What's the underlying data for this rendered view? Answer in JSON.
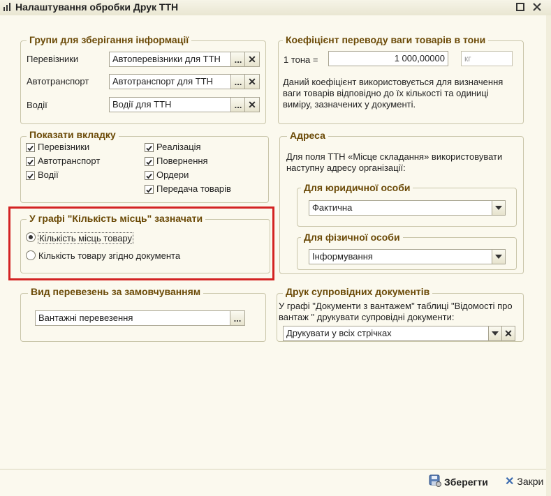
{
  "window": {
    "title": "Налаштування обробки Друк ТТН"
  },
  "groups_storage": {
    "title": "Групи для зберігання інформації",
    "rows": [
      {
        "label": "Перевізники",
        "value": "Автоперевізники для ТТН"
      },
      {
        "label": "Автотранспорт",
        "value": "Автотранспорт для ТТН"
      },
      {
        "label": "Водії",
        "value": "Водії для ТТН"
      }
    ]
  },
  "weight_coef": {
    "title": "Коефіцієнт переводу ваги товарів в тони",
    "ton_label": "1 тона =",
    "value": "1 000,00000",
    "unit": "кг",
    "note": "Даний коефіцієнт використовується для визначення ваги товарів відповідно до їх кількості та одиниці виміру, зазначених у документі."
  },
  "show_tab": {
    "title": "Показати вкладку",
    "left": [
      "Перевізники",
      "Автотранспорт",
      "Водії"
    ],
    "right": [
      "Реалізація",
      "Повернення",
      "Ордери",
      "Передача товарів"
    ]
  },
  "places": {
    "title": "У графі \"Кількість місць\" зазначати",
    "options": [
      "Кількість місць товару",
      "Кількість товару згідно документа"
    ],
    "selected": 0
  },
  "address": {
    "title": "Адреса",
    "note": "Для поля ТТН «Місце складання» використовувати наступну адресу організації:",
    "legal_title": "Для юридичної особи",
    "legal_value": "Фактична",
    "person_title": "Для фізичної особи",
    "person_value": "Інформування"
  },
  "transport_kind": {
    "title": "Вид перевезень за замовчуванням",
    "value": "Вантажні перевезення"
  },
  "docs": {
    "title": "Друк супровідних документів",
    "note": "У графі \"Документи з вантажем\" таблиці \"Відомості про вантаж \" друкувати супровідні документи:",
    "value": "Друкувати у всіх стрічках"
  },
  "footer": {
    "save": "Зберегти",
    "close": "Закри"
  },
  "colors": {
    "accent": "#6b4a07",
    "highlight": "#d32323"
  }
}
